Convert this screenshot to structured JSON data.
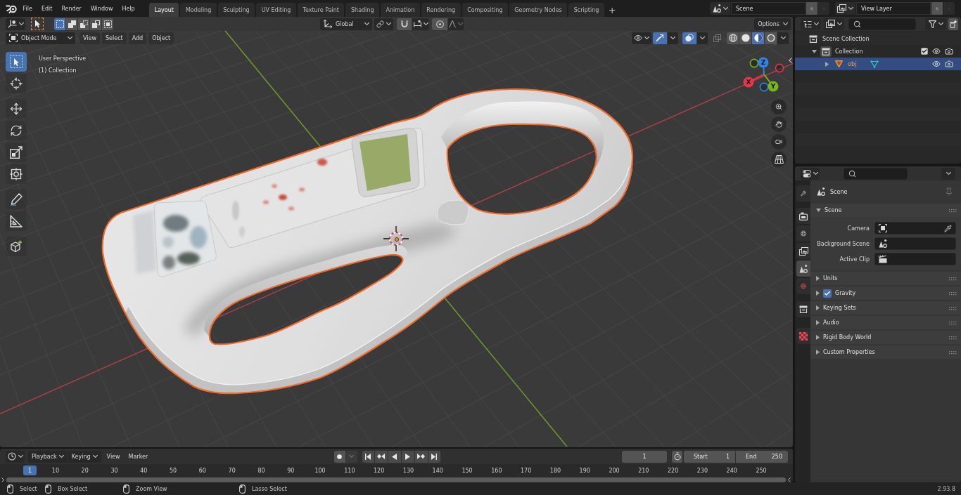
{
  "top_bar": {
    "menus": [
      "File",
      "Edit",
      "Render",
      "Window",
      "Help"
    ],
    "workspaces": [
      {
        "label": "Layout",
        "selected": true
      },
      {
        "label": "Modeling",
        "selected": false
      },
      {
        "label": "Sculpting",
        "selected": false
      },
      {
        "label": "UV Editing",
        "selected": false
      },
      {
        "label": "Texture Paint",
        "selected": false
      },
      {
        "label": "Shading",
        "selected": false
      },
      {
        "label": "Animation",
        "selected": false
      },
      {
        "label": "Rendering",
        "selected": false
      },
      {
        "label": "Compositing",
        "selected": false
      },
      {
        "label": "Geometry Nodes",
        "selected": false
      },
      {
        "label": "Scripting",
        "selected": false
      }
    ],
    "add_workspace": "+",
    "scene": "Scene",
    "view_layer": "View Layer"
  },
  "viewport": {
    "select_modes": [
      {
        "kind": "set",
        "selected": true
      },
      {
        "kind": "extend",
        "selected": false
      },
      {
        "kind": "subtract",
        "selected": false
      },
      {
        "kind": "invert",
        "selected": false
      },
      {
        "kind": "intersect",
        "selected": false
      }
    ],
    "transform_orientation": "Global",
    "snap": {
      "on": false
    },
    "proportional_editing": {
      "on": false
    },
    "options": "Options",
    "mode": "Object Mode",
    "menus": [
      "View",
      "Select",
      "Add",
      "Object"
    ],
    "gizmos": {
      "on": true
    },
    "overlays": {
      "on": true
    },
    "xray": {
      "on": false
    },
    "shading_modes": [
      {
        "kind": "wireframe",
        "selected": false
      },
      {
        "kind": "solid",
        "selected": false
      },
      {
        "kind": "material",
        "selected": true
      },
      {
        "kind": "rendered",
        "selected": false
      }
    ],
    "view_name": "User Perspective",
    "collection_label": "(1) Collection",
    "tools": [
      {
        "kind": "select_box",
        "selected": true
      },
      {
        "kind": "cursor",
        "selected": false
      },
      {
        "kind": "move",
        "selected": false
      },
      {
        "kind": "rotate",
        "selected": false
      },
      {
        "kind": "scale",
        "selected": false
      },
      {
        "kind": "transform",
        "selected": false
      },
      {
        "kind": "annotate",
        "selected": false
      },
      {
        "kind": "measure",
        "selected": false
      },
      {
        "kind": "add_cube",
        "selected": false
      }
    ],
    "gizmo_axes": [
      {
        "label": "Z",
        "color": "#2f84e4"
      },
      {
        "label": "X",
        "color": "#e5364c"
      },
      {
        "label": "Y",
        "color": "#78b41c"
      }
    ]
  },
  "outliner": {
    "items": [
      {
        "label": "Scene Collection",
        "kind": "scene_collection",
        "active": false,
        "selected": false,
        "children": [
          {
            "label": "Collection",
            "kind": "collection",
            "active": true,
            "selected": false,
            "expanded": true,
            "checked": true,
            "visible": true,
            "renderable": true,
            "children": [
              {
                "label": "obj",
                "kind": "mesh",
                "active": false,
                "selected": true,
                "expanded": false,
                "visible": true,
                "renderable": true
              }
            ]
          }
        ]
      }
    ]
  },
  "properties": {
    "tabs": [
      {
        "kind": "tool",
        "selected": false
      },
      {
        "kind": "render",
        "selected": false
      },
      {
        "kind": "output",
        "selected": false
      },
      {
        "kind": "view_layer",
        "selected": false
      },
      {
        "kind": "scene",
        "selected": true
      },
      {
        "kind": "world",
        "selected": false
      },
      {
        "kind": "collection",
        "selected": false
      },
      {
        "kind": "texture",
        "selected": false
      }
    ],
    "context": "Scene",
    "panels": [
      {
        "title": "Scene",
        "expanded": true,
        "fields": [
          {
            "label": "Camera",
            "kind": "object"
          },
          {
            "label": "Background Scene",
            "kind": "scene"
          },
          {
            "label": "Active Clip",
            "kind": "clip"
          }
        ]
      },
      {
        "title": "Units",
        "expanded": false
      },
      {
        "title": "Gravity",
        "expanded": false,
        "checked": true
      },
      {
        "title": "Keying Sets",
        "expanded": false
      },
      {
        "title": "Audio",
        "expanded": false
      },
      {
        "title": "Rigid Body World",
        "expanded": false
      },
      {
        "title": "Custom Properties",
        "expanded": false
      }
    ]
  },
  "timeline": {
    "menus": [
      {
        "label": "Playback",
        "kind": "dropdown"
      },
      {
        "label": "Keying",
        "kind": "dropdown"
      },
      {
        "label": "View",
        "kind": "menu"
      },
      {
        "label": "Marker",
        "kind": "menu"
      }
    ],
    "auto_keying": {
      "on": false
    },
    "current_frame": "1",
    "preview_range": {
      "on": false
    },
    "start_label": "Start",
    "start": "1",
    "end_label": "End",
    "end": "250",
    "playhead": "1",
    "ruler": [
      "10",
      "20",
      "30",
      "40",
      "50",
      "60",
      "70",
      "80",
      "90",
      "100",
      "110",
      "120",
      "130",
      "140",
      "150",
      "160",
      "170",
      "180",
      "190",
      "200",
      "210",
      "220",
      "230",
      "240",
      "250"
    ]
  },
  "status_bar": {
    "hints": [
      "Select",
      "Box Select",
      "Zoom View",
      "Lasso Select"
    ],
    "version": "2.93.8"
  }
}
